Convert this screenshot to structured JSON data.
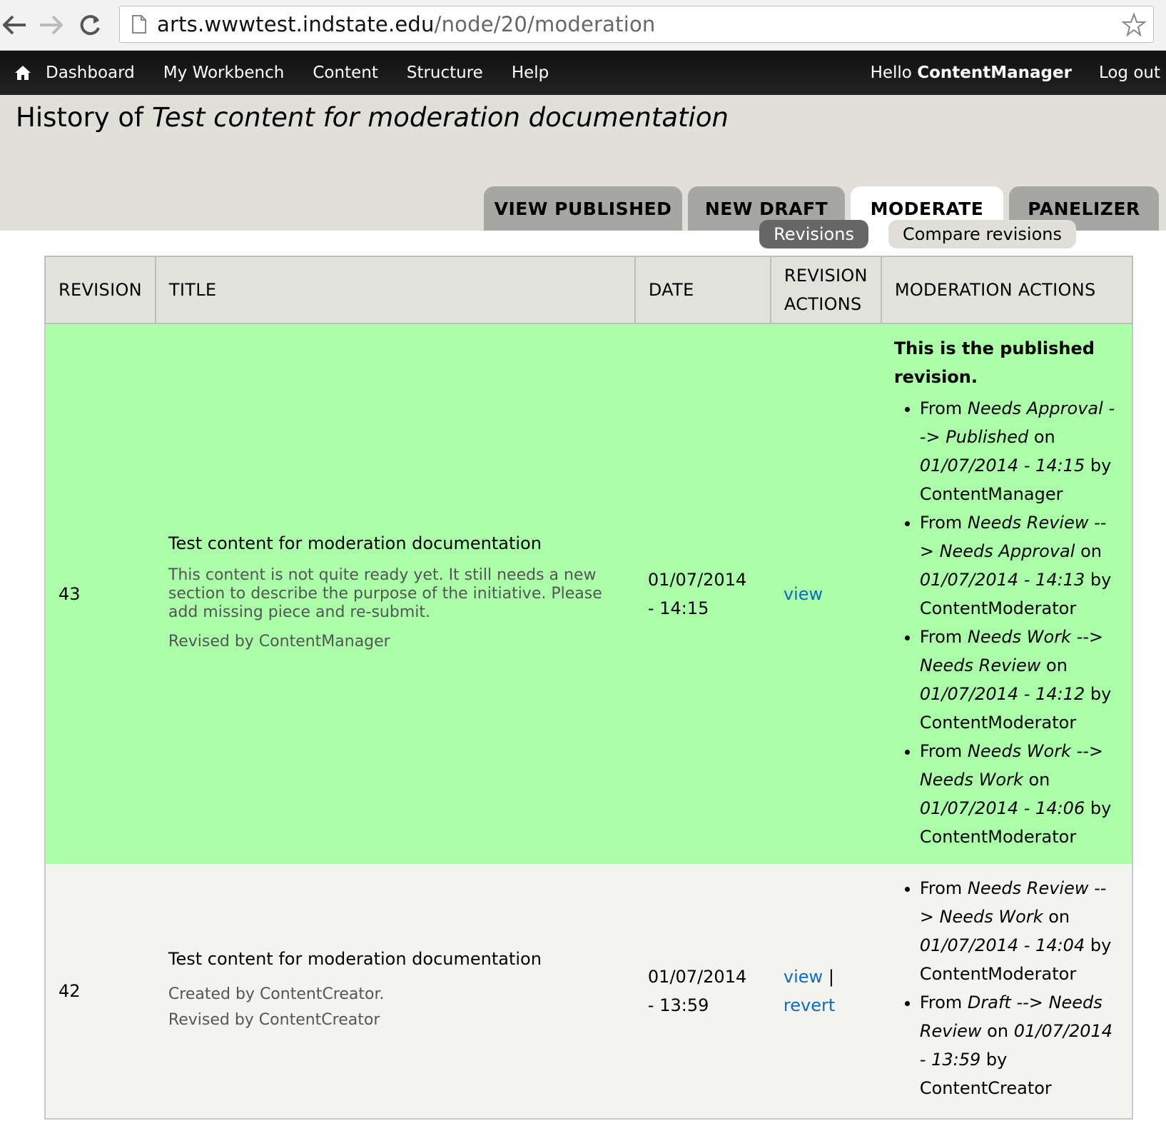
{
  "browser": {
    "url_host": "arts.wwwtest.indstate.edu",
    "url_path": "/node/20/moderation",
    "back_icon": "back-arrow-icon",
    "forward_icon": "forward-arrow-icon",
    "reload_icon": "reload-icon",
    "bookmark_icon": "star-icon"
  },
  "toolbar": {
    "home_icon": "home-icon",
    "items": [
      "Dashboard",
      "My Workbench",
      "Content",
      "Structure",
      "Help"
    ],
    "hello_prefix": "Hello",
    "username": "ContentManager",
    "logout": "Log out"
  },
  "page": {
    "title_prefix": "History of",
    "title_node": "Test content for moderation documentation"
  },
  "tabs": [
    "VIEW PUBLISHED",
    "NEW DRAFT",
    "MODERATE",
    "PANELIZER"
  ],
  "active_tab": "MODERATE",
  "secondary_tabs": [
    "Revisions",
    "Compare revisions"
  ],
  "table": {
    "headers": [
      "REVISION",
      "TITLE",
      "DATE",
      "REVISION ACTIONS",
      "MODERATION ACTIONS"
    ],
    "header_revision_actions_line1": "REVISION",
    "header_revision_actions_line2": "ACTIONS",
    "rows": [
      {
        "revision": "43",
        "title": "Test content for moderation documentation",
        "log_message": "This content is not quite ready yet. It still needs a new section to describe the purpose of the initiative. Please add missing piece and re-submit.",
        "revised_by": "Revised by ContentManager",
        "date_line1": "01/07/2014",
        "date_line2": "- 14:15",
        "action_view": "view",
        "published_note": "This is the published revision.",
        "history": [
          {
            "from": "Needs Approval",
            "to": "Published",
            "on": "01/07/2014 - 14:15",
            "by": "ContentManager"
          },
          {
            "from": "Needs Review",
            "to": "Needs Approval",
            "on": "01/07/2014 - 14:13",
            "by": "ContentModerator"
          },
          {
            "from": "Needs Work",
            "to": "Needs Review",
            "on": "01/07/2014 - 14:12",
            "by": "ContentModerator"
          },
          {
            "from": "Needs Work",
            "to": "Needs Work",
            "on": "01/07/2014 - 14:06",
            "by": "ContentModerator"
          }
        ]
      },
      {
        "revision": "42",
        "title": "Test content for moderation documentation",
        "log_message": "Created by ContentCreator.",
        "revised_by": "Revised by ContentCreator",
        "date_line1": "01/07/2014",
        "date_line2": "- 13:59",
        "action_view": "view",
        "action_sep": "|",
        "action_revert": "revert",
        "history": [
          {
            "from": "Needs Review",
            "to": "Needs Work",
            "on": "01/07/2014 - 14:04",
            "by": "ContentModerator"
          },
          {
            "from": "Draft",
            "to": "Needs Review",
            "on": "01/07/2014 - 13:59",
            "by": "ContentCreator"
          }
        ]
      }
    ],
    "history_words": {
      "from": "From",
      "arrow": "-->",
      "on": "on",
      "by": "by"
    }
  }
}
